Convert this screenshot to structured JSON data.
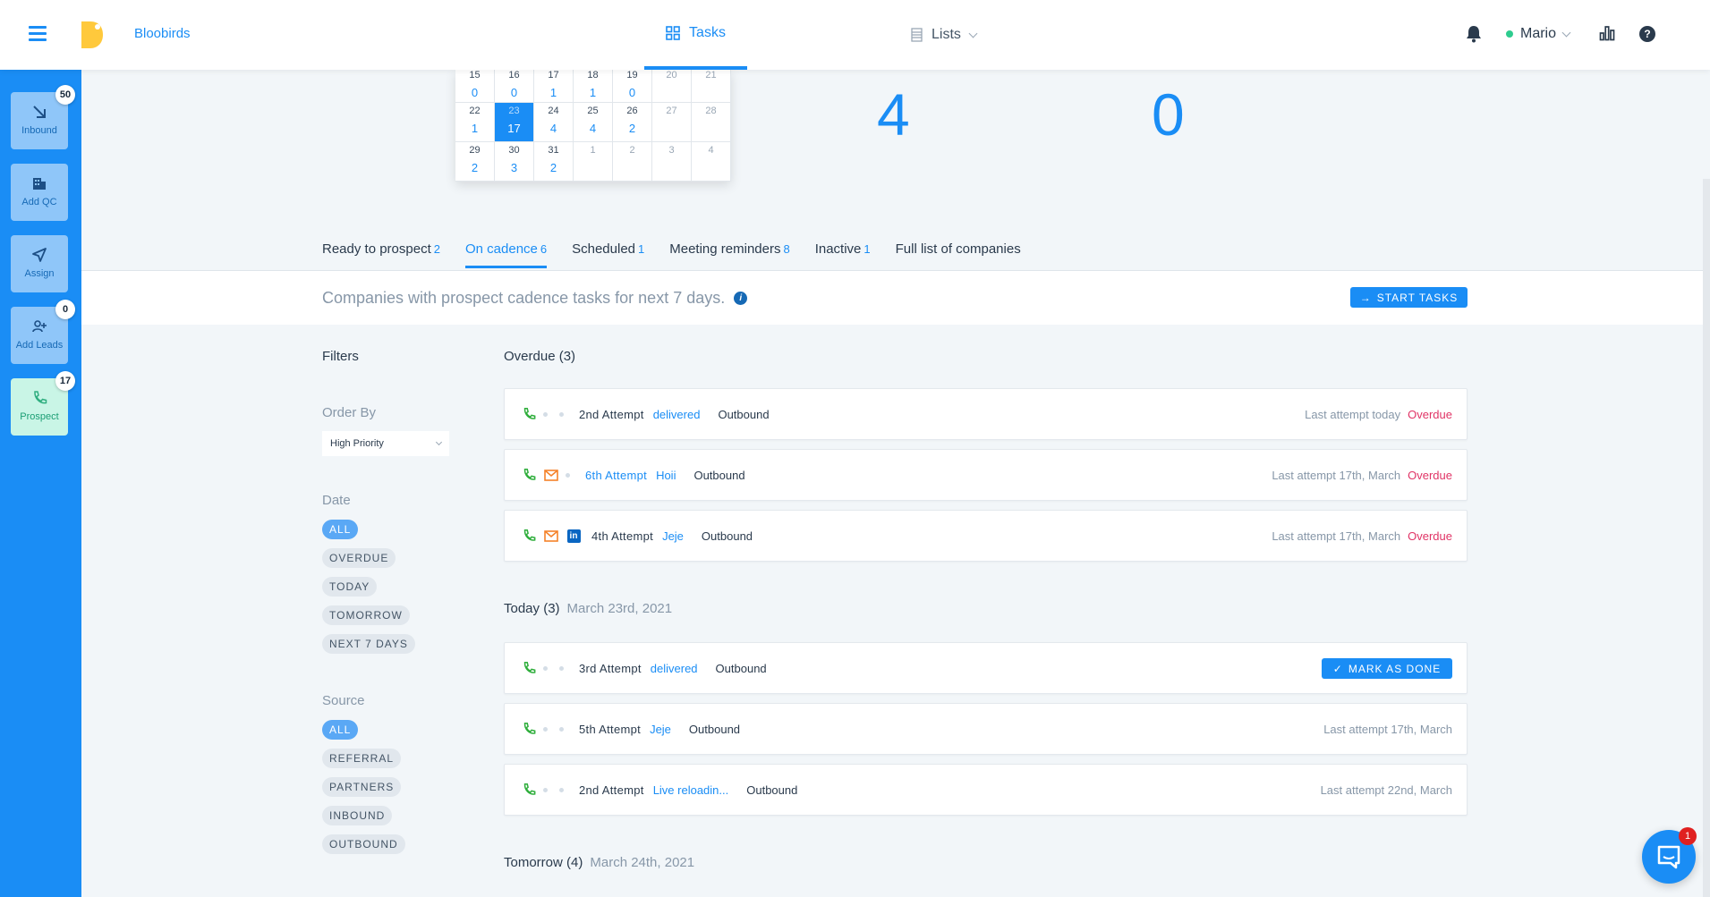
{
  "header": {
    "brand": "Bloobirds",
    "nav_tasks": "Tasks",
    "nav_lists": "Lists",
    "user": "Mario"
  },
  "sidebar": [
    {
      "label": "Inbound",
      "badge": "50",
      "icon": "arrow-down-right-icon"
    },
    {
      "label": "Add QC",
      "badge": "",
      "icon": "building-icon"
    },
    {
      "label": "Assign",
      "badge": "",
      "icon": "send-icon"
    },
    {
      "label": "Add Leads",
      "badge": "0",
      "icon": "add-user-icon"
    },
    {
      "label": "Prospect",
      "badge": "17",
      "icon": "phone-icon"
    }
  ],
  "calendar": {
    "rows": [
      [
        [
          "15",
          "0"
        ],
        [
          "16",
          "0"
        ],
        [
          "17",
          "1"
        ],
        [
          "18",
          "1"
        ],
        [
          "19",
          "0"
        ],
        [
          "20",
          ""
        ],
        [
          "21",
          ""
        ]
      ],
      [
        [
          "22",
          "1"
        ],
        [
          "23",
          "17"
        ],
        [
          "24",
          "4"
        ],
        [
          "25",
          "4"
        ],
        [
          "26",
          "2"
        ],
        [
          "27",
          ""
        ],
        [
          "28",
          ""
        ]
      ],
      [
        [
          "29",
          "2"
        ],
        [
          "30",
          "3"
        ],
        [
          "31",
          "2"
        ],
        [
          "1",
          ""
        ],
        [
          "2",
          ""
        ],
        [
          "3",
          ""
        ],
        [
          "4",
          ""
        ]
      ]
    ],
    "selected": "23"
  },
  "stats": {
    "first": "4",
    "second": "0"
  },
  "tabs": [
    {
      "label": "Ready to prospect",
      "count": "2"
    },
    {
      "label": "On cadence",
      "count": "6"
    },
    {
      "label": "Scheduled",
      "count": "1"
    },
    {
      "label": "Meeting reminders",
      "count": "8"
    },
    {
      "label": "Inactive",
      "count": "1"
    },
    {
      "label": "Full list of companies",
      "count": ""
    }
  ],
  "subheader": {
    "text": "Companies with prospect cadence tasks for next 7 days.",
    "start_tasks": "START TASKS"
  },
  "filters": {
    "title": "Filters",
    "order_by_label": "Order By",
    "order_by_value": "High Priority",
    "date_label": "Date",
    "date_options": [
      "ALL",
      "OVERDUE",
      "TODAY",
      "TOMORROW",
      "NEXT 7 DAYS"
    ],
    "source_label": "Source",
    "source_options": [
      "ALL",
      "REFERRAL",
      "PARTNERS",
      "INBOUND",
      "OUTBOUND"
    ]
  },
  "sections": {
    "overdue": {
      "title": "Overdue (3)",
      "date": ""
    },
    "today": {
      "title": "Today (3)",
      "date": "March 23rd, 2021"
    },
    "tomorrow": {
      "title": "Tomorrow (4)",
      "date": "March 24th, 2021"
    }
  },
  "tasks": [
    {
      "attempt": "2nd Attempt",
      "tag": "delivered",
      "source": "Outbound",
      "last": "Last attempt today",
      "status": "Overdue"
    },
    {
      "attempt": "6th Attempt",
      "tag": "Hoii",
      "source": "Outbound",
      "last": "Last attempt 17th, March",
      "status": "Overdue"
    },
    {
      "attempt": "4th Attempt",
      "tag": "Jeje",
      "source": "Outbound",
      "last": "Last attempt 17th, March",
      "status": "Overdue"
    },
    {
      "attempt": "3rd Attempt",
      "tag": "delivered",
      "source": "Outbound",
      "last": "",
      "status": ""
    },
    {
      "attempt": "5th Attempt",
      "tag": "Jeje",
      "source": "Outbound",
      "last": "Last attempt 17th, March",
      "status": ""
    },
    {
      "attempt": "2nd Attempt",
      "tag": "Live reloadin...",
      "source": "Outbound",
      "last": "Last attempt 22nd, March",
      "status": ""
    }
  ],
  "mark_done": "MARK AS DONE",
  "chat_badge": "1",
  "colors": {
    "accent": "#1a8df5",
    "overdue": "#e03466",
    "prospect_active": "#c9f5e6"
  }
}
